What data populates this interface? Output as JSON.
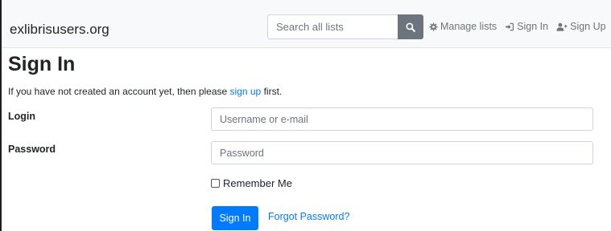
{
  "navbar": {
    "brand": "exlibrisusers.org",
    "search_placeholder": "Search all lists",
    "links": {
      "manage_lists": "Manage lists",
      "sign_in": "Sign In",
      "sign_up": "Sign Up"
    }
  },
  "page": {
    "title": "Sign In",
    "intro_before": "If you have not created an account yet, then please ",
    "intro_link": "sign up",
    "intro_after": " first."
  },
  "form": {
    "login_label": "Login",
    "login_placeholder": "Username or e-mail",
    "password_label": "Password",
    "password_placeholder": "Password",
    "remember_label": "Remember Me",
    "submit_label": "Sign In",
    "forgot_label": "Forgot Password?"
  },
  "colors": {
    "navbar_bg": "#f8f9fa",
    "link": "#007bff",
    "primary_button": "#007bff",
    "search_button": "#6c757d"
  },
  "icons": {
    "search": "search-icon",
    "manage": "gear-icon",
    "sign_in": "sign-in-icon",
    "sign_up": "user-plus-icon"
  }
}
